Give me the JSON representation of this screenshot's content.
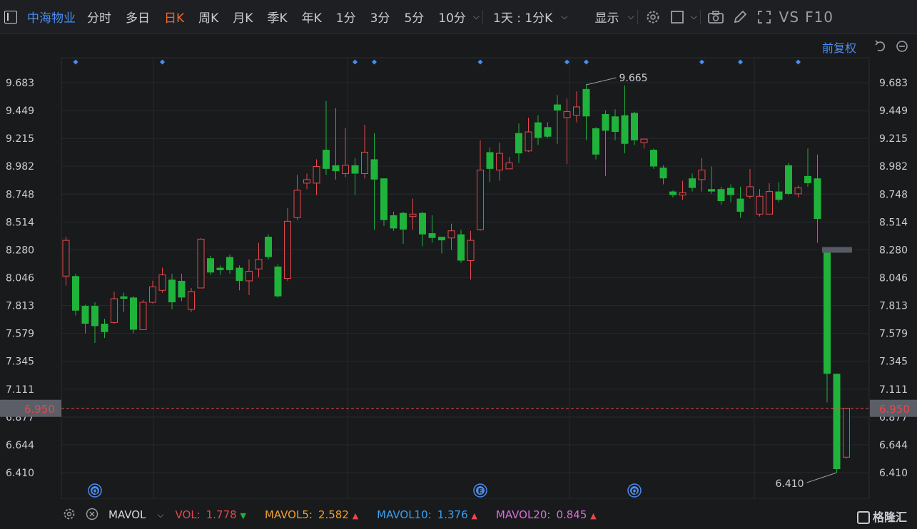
{
  "toolbar": {
    "title": "中海物业",
    "periods": [
      "分时",
      "多日",
      "日K",
      "周K",
      "月K",
      "季K",
      "年K",
      "1分",
      "3分",
      "5分",
      "10分"
    ],
    "active_period": "日K",
    "interval_select": "1天 : 1分K",
    "display_label": "显示",
    "vs_label": "VS",
    "f10_label": "F10"
  },
  "chart_header": {
    "adjust_label": "前复权"
  },
  "chart_data": {
    "type": "candlestick",
    "ylim": [
      6.3,
      9.9
    ],
    "y_ticks": [
      9.683,
      9.449,
      9.215,
      8.982,
      8.748,
      8.514,
      8.28,
      8.046,
      7.813,
      7.579,
      7.345,
      7.111,
      6.877,
      6.644,
      6.41
    ],
    "current_price": 6.95,
    "current_price_label": "6.950",
    "max_label": "9.665",
    "min_label": "6.410",
    "up_color": "#e5484d",
    "down_color": "#1fb33b",
    "markers": [
      {
        "index": 1,
        "kind": "diamond"
      },
      {
        "index": 10,
        "kind": "diamond"
      },
      {
        "index": 30,
        "kind": "diamond"
      },
      {
        "index": 32,
        "kind": "diamond"
      },
      {
        "index": 43,
        "kind": "diamond"
      },
      {
        "index": 52,
        "kind": "diamond"
      },
      {
        "index": 54,
        "kind": "diamond"
      },
      {
        "index": 66,
        "kind": "diamond"
      },
      {
        "index": 70,
        "kind": "diamond"
      },
      {
        "index": 76,
        "kind": "diamond"
      }
    ],
    "events": [
      {
        "index": 3,
        "label": "Q"
      },
      {
        "index": 43,
        "label": "E"
      },
      {
        "index": 59,
        "label": "Q"
      }
    ],
    "candles": [
      [
        8.06,
        8.36,
        8.39,
        7.98
      ],
      [
        8.06,
        7.77,
        8.08,
        7.73
      ],
      [
        7.81,
        7.66,
        7.82,
        7.58
      ],
      [
        7.81,
        7.64,
        7.84,
        7.5
      ],
      [
        7.66,
        7.59,
        7.7,
        7.54
      ],
      [
        7.67,
        7.87,
        7.93,
        7.66
      ],
      [
        7.89,
        7.87,
        7.92,
        7.76
      ],
      [
        7.88,
        7.61,
        7.89,
        7.58
      ],
      [
        7.61,
        7.84,
        7.86,
        7.61
      ],
      [
        7.84,
        7.97,
        8.02,
        7.83
      ],
      [
        7.94,
        8.07,
        8.13,
        7.92
      ],
      [
        8.03,
        7.84,
        8.08,
        7.78
      ],
      [
        8.02,
        7.88,
        8.08,
        7.85
      ],
      [
        7.78,
        7.93,
        7.96,
        7.76
      ],
      [
        7.96,
        8.37,
        8.38,
        7.96
      ],
      [
        8.21,
        8.09,
        8.23,
        8.07
      ],
      [
        8.13,
        8.11,
        8.15,
        8.07
      ],
      [
        8.22,
        8.11,
        8.24,
        8.08
      ],
      [
        8.13,
        8.02,
        8.15,
        7.94
      ],
      [
        8.02,
        8.1,
        8.2,
        7.9
      ],
      [
        8.12,
        8.2,
        8.34,
        8.05
      ],
      [
        8.39,
        8.22,
        8.41,
        8.2
      ],
      [
        8.14,
        7.89,
        8.16,
        7.88
      ],
      [
        8.04,
        8.52,
        8.63,
        8.02
      ],
      [
        8.55,
        8.78,
        8.91,
        8.53
      ],
      [
        8.84,
        8.87,
        8.92,
        8.79
      ],
      [
        8.84,
        8.98,
        9.04,
        8.74
      ],
      [
        9.12,
        8.96,
        9.53,
        8.91
      ],
      [
        8.99,
        8.94,
        9.47,
        8.87
      ],
      [
        8.92,
        8.99,
        9.3,
        8.89
      ],
      [
        8.99,
        8.92,
        9.05,
        8.74
      ],
      [
        8.92,
        9.1,
        9.33,
        8.88
      ],
      [
        9.04,
        8.87,
        9.26,
        8.45
      ],
      [
        8.88,
        8.53,
        8.88,
        8.48
      ],
      [
        8.57,
        8.46,
        8.6,
        8.44
      ],
      [
        8.59,
        8.45,
        8.6,
        8.33
      ],
      [
        8.56,
        8.58,
        8.71,
        8.45
      ],
      [
        8.59,
        8.41,
        8.6,
        8.31
      ],
      [
        8.42,
        8.38,
        8.57,
        8.34
      ],
      [
        8.39,
        8.36,
        8.39,
        8.25
      ],
      [
        8.38,
        8.44,
        8.5,
        8.28
      ],
      [
        8.41,
        8.19,
        8.45,
        8.17
      ],
      [
        8.19,
        8.36,
        8.44,
        8.03
      ],
      [
        8.45,
        8.95,
        9.2,
        8.44
      ],
      [
        9.1,
        8.96,
        9.14,
        8.85
      ],
      [
        8.95,
        9.09,
        9.18,
        8.86
      ],
      [
        8.96,
        9.01,
        9.06,
        8.96
      ],
      [
        9.26,
        9.09,
        9.34,
        9.01
      ],
      [
        9.11,
        9.27,
        9.39,
        9.1
      ],
      [
        9.35,
        9.22,
        9.41,
        9.16
      ],
      [
        9.31,
        9.23,
        9.35,
        9.22
      ],
      [
        9.5,
        9.45,
        9.58,
        9.17
      ],
      [
        9.39,
        9.44,
        9.55,
        9.0
      ],
      [
        9.41,
        9.48,
        9.61,
        9.35
      ],
      [
        9.63,
        9.4,
        9.67,
        9.2
      ],
      [
        9.3,
        9.08,
        9.31,
        9.04
      ],
      [
        9.42,
        9.28,
        9.45,
        8.9
      ],
      [
        9.4,
        9.27,
        9.46,
        9.2
      ],
      [
        9.41,
        9.17,
        9.66,
        9.09
      ],
      [
        9.43,
        9.2,
        9.44,
        9.16
      ],
      [
        9.18,
        9.21,
        9.21,
        9.13
      ],
      [
        9.12,
        8.98,
        9.13,
        8.96
      ],
      [
        8.97,
        8.88,
        8.99,
        8.83
      ],
      [
        8.77,
        8.74,
        8.78,
        8.72
      ],
      [
        8.74,
        8.76,
        8.86,
        8.7
      ],
      [
        8.88,
        8.8,
        8.92,
        8.77
      ],
      [
        8.87,
        8.95,
        9.05,
        8.77
      ],
      [
        8.79,
        8.77,
        8.98,
        8.75
      ],
      [
        8.79,
        8.69,
        8.81,
        8.66
      ],
      [
        8.8,
        8.74,
        8.83,
        8.68
      ],
      [
        8.71,
        8.6,
        8.81,
        8.55
      ],
      [
        8.73,
        8.81,
        8.96,
        8.71
      ],
      [
        8.58,
        8.73,
        8.79,
        8.56
      ],
      [
        8.58,
        8.77,
        8.84,
        8.58
      ],
      [
        8.77,
        8.7,
        8.85,
        8.68
      ],
      [
        8.99,
        8.75,
        9.01,
        8.74
      ],
      [
        8.75,
        8.8,
        8.82,
        8.72
      ],
      [
        8.9,
        8.84,
        9.13,
        8.81
      ],
      [
        8.88,
        8.54,
        9.08,
        8.34
      ],
      [
        8.27,
        7.24,
        8.27,
        7.0
      ],
      [
        7.24,
        6.44,
        7.24,
        6.41
      ],
      [
        6.54,
        6.95,
        6.95,
        6.53
      ]
    ],
    "suspension_bar": {
      "index": 79,
      "price": 8.28
    }
  },
  "indicator": {
    "name": "MAVOL",
    "vol_label": "VOL:",
    "vol_value": "1.778",
    "mavol5_label": "MAVOL5:",
    "mavol5_value": "2.582",
    "mavol10_label": "MAVOL10:",
    "mavol10_value": "1.376",
    "mavol20_label": "MAVOL20:",
    "mavol20_value": "0.845",
    "colors": {
      "vol": "#e5484d",
      "mavol5": "#f0a030",
      "mavol10": "#3aa0f0",
      "mavol20": "#d86ed8"
    }
  },
  "branding": {
    "logo_text": "格隆汇"
  }
}
